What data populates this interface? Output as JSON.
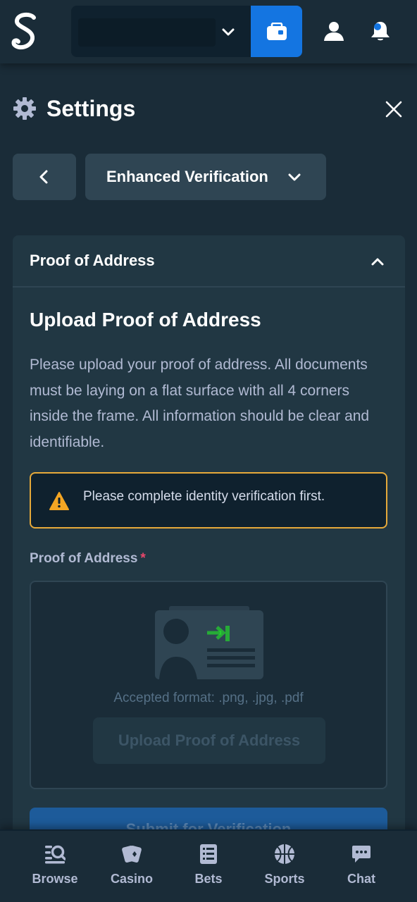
{
  "topbar": {
    "logo_icon": "stake-logo-icon",
    "balance_value": "",
    "wallet_icon": "wallet-icon",
    "user_icon": "user-icon",
    "bell_icon": "bell-icon",
    "accent_color": "#1475e1"
  },
  "settings": {
    "title": "Settings",
    "icon": "gear-icon",
    "close_icon": "close-icon"
  },
  "nav": {
    "back_icon": "chevron-left-icon",
    "section_label": "Enhanced Verification",
    "section_chevron": "chevron-down-icon"
  },
  "card": {
    "header_title": "Proof of Address",
    "header_chevron": "chevron-up-icon",
    "upload_title": "Upload Proof of Address",
    "description": "Please upload your proof of address. All documents must be laying on a flat surface with all 4 corners inside the frame. All information should be clear and identifiable.",
    "warning": {
      "icon": "warning-icon",
      "text": "Please complete identity verification first.",
      "color": "#e6a93a"
    },
    "field_label": "Proof of Address",
    "required_marker": "*",
    "dropzone": {
      "illustration": "document-upload-icon",
      "accepted_format": "Accepted format: .png, .jpg, .pdf",
      "upload_button": "Upload Proof of Address"
    },
    "submit_button": "Submit for Verification"
  },
  "bottom_nav": {
    "items": [
      {
        "label": "Browse",
        "icon": "browse-search-icon"
      },
      {
        "label": "Casino",
        "icon": "cards-icon"
      },
      {
        "label": "Bets",
        "icon": "bets-list-icon"
      },
      {
        "label": "Sports",
        "icon": "basketball-icon"
      },
      {
        "label": "Chat",
        "icon": "chat-icon"
      }
    ]
  }
}
